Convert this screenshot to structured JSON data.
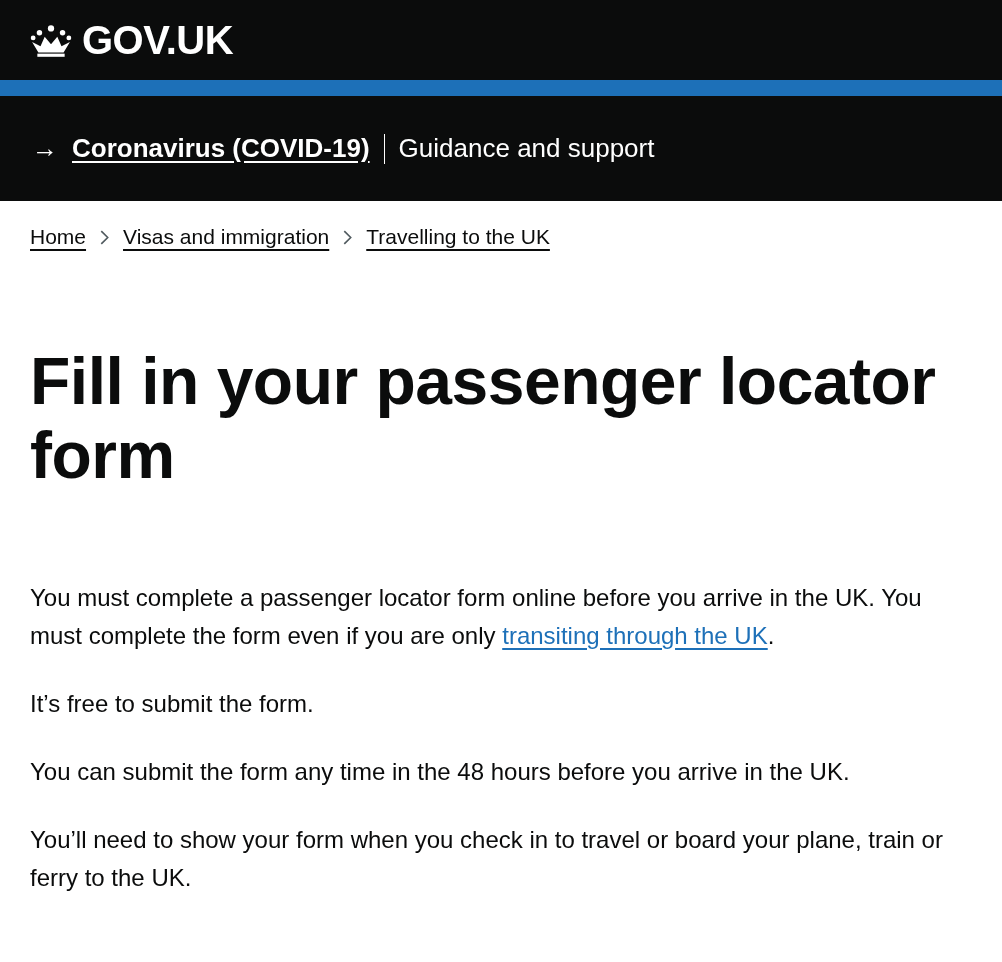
{
  "header": {
    "logo_text": "GOV.UK"
  },
  "covid_banner": {
    "arrow": "→",
    "link": "Coronavirus (COVID-19)",
    "text": "Guidance and support"
  },
  "breadcrumbs": [
    {
      "label": "Home"
    },
    {
      "label": "Visas and immigration"
    },
    {
      "label": "Travelling to the UK"
    }
  ],
  "title": "Fill in your passenger locator form",
  "paragraphs": [
    {
      "parts": [
        {
          "kind": "text",
          "text": "You must complete a passenger locator form online before you arrive in the UK. You must complete the form even if you are only "
        },
        {
          "kind": "link",
          "text": "transiting through the UK"
        },
        {
          "kind": "text",
          "text": "."
        }
      ]
    },
    {
      "parts": [
        {
          "kind": "text",
          "text": "It’s free to submit the form."
        }
      ]
    },
    {
      "parts": [
        {
          "kind": "text",
          "text": "You can submit the form any time in the 48 hours before you arrive in the UK."
        }
      ]
    },
    {
      "parts": [
        {
          "kind": "text",
          "text": "You’ll need to show your form when you check in to travel or board your plane, train or ferry to the UK."
        }
      ]
    }
  ]
}
